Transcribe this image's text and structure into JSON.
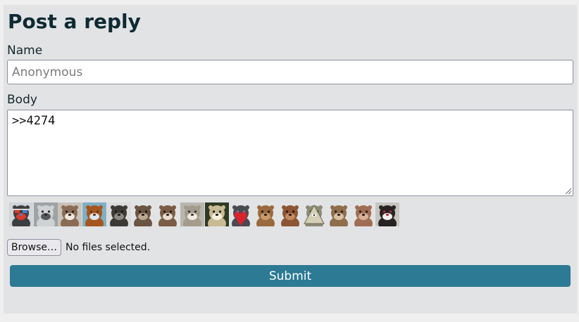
{
  "form": {
    "title": "Post a reply",
    "name_label": "Name",
    "name_placeholder": "Anonymous",
    "body_label": "Body",
    "body_value": ">>4274",
    "browse_label": "Browse…",
    "file_status": "No files selected.",
    "submit_label": "Submit"
  },
  "emotes": [
    {
      "icon": "otter-3d-glasses-emote",
      "bg": "#cfd5d8",
      "fur": "#3c3e40",
      "accent": "#d93a2c",
      "accent2": "#4a7fc8"
    },
    {
      "icon": "otter-hooded-emote",
      "bg": "#9ea3a5",
      "fur": "#cfd2d2",
      "accent": "#56585a",
      "accent2": "#2a2a2a"
    },
    {
      "icon": "otter-smiling-emote",
      "bg": "#c9c2bb",
      "fur": "#8a6c55",
      "accent": "#f2e8df",
      "accent2": "#2a1f18"
    },
    {
      "icon": "otter-dancing-emote",
      "bg": "#7fb0c4",
      "fur": "#a5561e",
      "accent": "#d8e6ec",
      "accent2": "#5e3512"
    },
    {
      "icon": "otter-side-profile-emote",
      "bg": "#dcdcdc",
      "fur": "#3d3a36",
      "accent": "#8c8982",
      "accent2": "#1c1a18"
    },
    {
      "icon": "otter-surprised-emote",
      "bg": "#e2e3e5",
      "fur": "#6a5442",
      "accent": "#bba88f",
      "accent2": "#1e1712"
    },
    {
      "icon": "otter-neck-emote",
      "bg": "#e2e3e5",
      "fur": "#7b5c47",
      "accent": "#e9dccf",
      "accent2": "#2a1c14"
    },
    {
      "icon": "otter-laughing-emote",
      "bg": "#b8b6af",
      "fur": "#a49b8a",
      "accent": "#efece3",
      "accent2": "#3a3329"
    },
    {
      "icon": "otter-shocked-emote",
      "bg": "#2f3a24",
      "fur": "#c9bb93",
      "accent": "#f6f0dc",
      "accent2": "#1b1a12"
    },
    {
      "icon": "otter-heart-emote",
      "bg": "#e2e3e5",
      "fur": "#4d4950",
      "accent": "#d8232d",
      "accent2": "#8a7f87"
    },
    {
      "icon": "otter-sitting-emote",
      "bg": "#e2e3e5",
      "fur": "#9a6a3e",
      "accent": "#c89a6b",
      "accent2": "#2a1b10"
    },
    {
      "icon": "otter-grumpy-emote",
      "bg": "#e2e3e5",
      "fur": "#8c5634",
      "accent": "#c48a62",
      "accent2": "#2a160b"
    },
    {
      "icon": "otter-illuminati-emote",
      "bg": "#e2e3e5",
      "fur": "#8d8a76",
      "accent": "#d3cfb4",
      "accent2": "#1e1e1e"
    },
    {
      "icon": "otter-chubby-emote",
      "bg": "#e2e3e5",
      "fur": "#8e6e4c",
      "accent": "#d8c2a3",
      "accent2": "#2b1d10"
    },
    {
      "icon": "otter-smug-emote",
      "bg": "#e2e3e5",
      "fur": "#a06e54",
      "accent": "#d7b29a",
      "accent2": "#2a1a12"
    },
    {
      "icon": "otter-screaming-emote",
      "bg": "#c8c5c0",
      "fur": "#262322",
      "accent": "#f1f0ee",
      "accent2": "#b03040"
    }
  ]
}
